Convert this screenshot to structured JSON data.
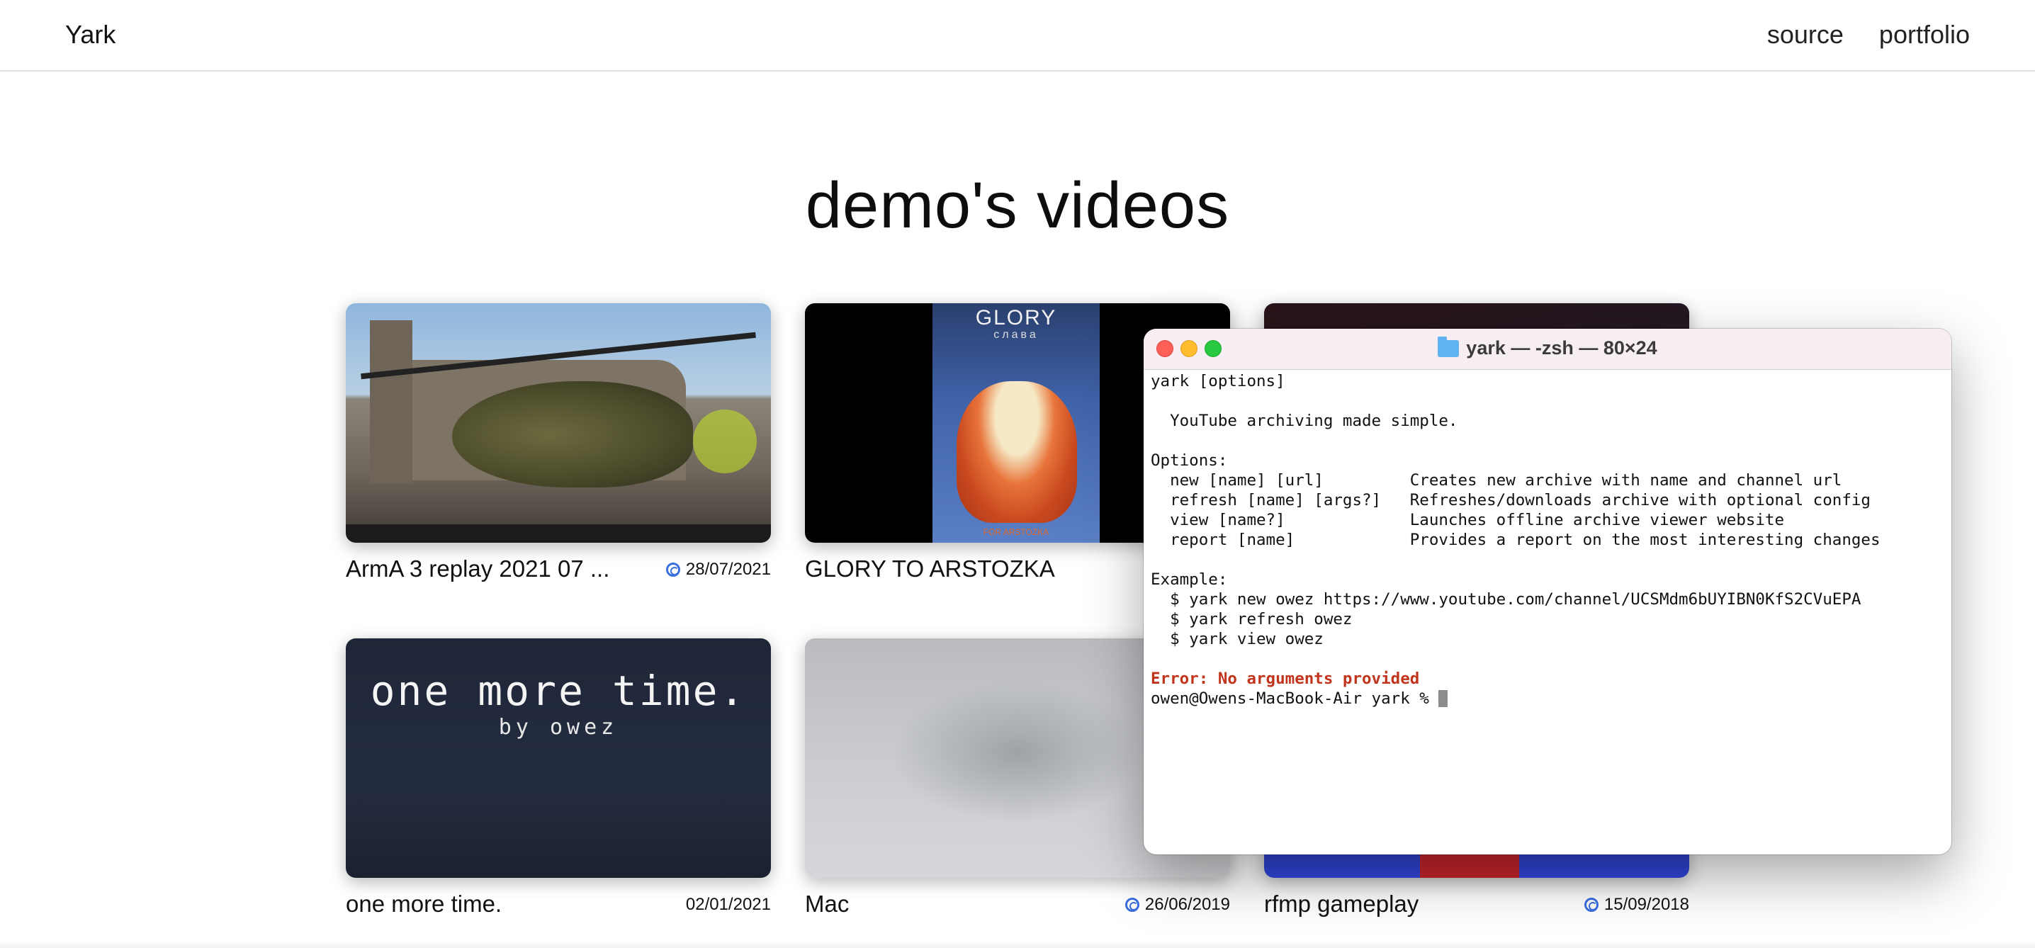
{
  "nav": {
    "brand": "Yark",
    "links": [
      "source",
      "portfolio"
    ]
  },
  "page": {
    "title": "demo's videos"
  },
  "videos": [
    {
      "title": "ArmA 3 replay 2021 07 ...",
      "date": "28/07/2021",
      "icon": "spiral-icon"
    },
    {
      "title": "GLORY TO ARSTOZKA",
      "date": "",
      "thumb_text": {
        "title": "GLORY",
        "subtitle": "слава",
        "footer": "FOR ARSTOZKA"
      }
    },
    {
      "title": "",
      "date": ""
    },
    {
      "title": "one more time.",
      "date": "02/01/2021",
      "thumb_text": {
        "title": "one more time.",
        "subtitle": "by owez"
      }
    },
    {
      "title": "Mac",
      "date": "26/06/2019",
      "icon": "spiral-icon"
    },
    {
      "title": "rfmp gameplay",
      "date": "15/09/2018",
      "icon": "spiral-icon"
    }
  ],
  "terminal": {
    "title": "yark — -zsh — 80×24",
    "lines": [
      "yark [options]",
      "",
      "  YouTube archiving made simple.",
      "",
      "Options:",
      "  new [name] [url]         Creates new archive with name and channel url",
      "  refresh [name] [args?]   Refreshes/downloads archive with optional config",
      "  view [name?]             Launches offline archive viewer website",
      "  report [name]            Provides a report on the most interesting changes",
      "",
      "Example:",
      "  $ yark new owez https://www.youtube.com/channel/UCSMdm6bUYIBN0KfS2CVuEPA",
      "  $ yark refresh owez",
      "  $ yark view owez",
      ""
    ],
    "error": "Error: No arguments provided",
    "prompt": "owen@Owens-MacBook-Air yark % "
  },
  "colors": {
    "accent_icon": "#3a6fe0",
    "error": "#c1351d",
    "traffic_red": "#fe5f57",
    "traffic_yellow": "#febc2e",
    "traffic_green": "#28c840"
  }
}
